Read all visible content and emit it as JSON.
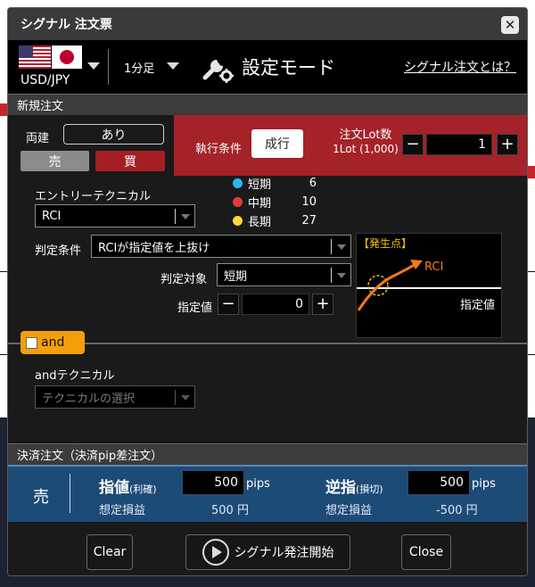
{
  "window": {
    "title": "シグナル 注文票"
  },
  "header": {
    "pair": "USD/JPY",
    "timeframe": "1分足",
    "mode_label": "設定モード",
    "help_link": "シグナル注文とは？"
  },
  "new_order": {
    "section_title": "新規注文",
    "ryodate_label": "両建",
    "ryodate_value": "あり",
    "sell_label": "売",
    "buy_label": "買",
    "exec_label": "執行条件",
    "market_label": "成行",
    "lot_label": "注文Lot数",
    "lot_sub": "1Lot (1,000)",
    "lot_minus": "−",
    "lot_value": "1",
    "lot_plus": "+"
  },
  "entry": {
    "label": "エントリーテクニカル",
    "technical": "RCI",
    "periods": [
      {
        "name": "短期",
        "value": "6",
        "color": "#29b6f6"
      },
      {
        "name": "中期",
        "value": "10",
        "color": "#e53935"
      },
      {
        "name": "長期",
        "value": "27",
        "color": "#fdd835"
      }
    ],
    "judge_label": "判定条件",
    "judge_value": "RCIが指定値を上抜け",
    "target_label": "判定対象",
    "target_value": "短期",
    "value_label": "指定値",
    "value_minus": "−",
    "value_value": "0",
    "value_plus": "+"
  },
  "diagram": {
    "title": "【発生点】",
    "series_label": "RCI",
    "line_label": "指定値"
  },
  "and_block": {
    "tab_label": "and",
    "label": "andテクニカル",
    "select_placeholder": "テクニカルの選択"
  },
  "settlement": {
    "section_title": "決済注文（決済pip差注文）",
    "side": "売",
    "limit_title": "指値",
    "limit_sub": "(利確)",
    "limit_value": "500",
    "limit_unit": "pips",
    "limit_pl_label": "想定損益",
    "limit_pl_value": "500 円",
    "stop_title": "逆指",
    "stop_sub": "(損切)",
    "stop_value": "500",
    "stop_unit": "pips",
    "stop_pl_label": "想定損益",
    "stop_pl_value": "-500 円"
  },
  "footer": {
    "clear_label": "Clear",
    "start_label": "シグナル発注開始",
    "close_label": "Close"
  },
  "colors": {
    "accent_red": "#a52229",
    "and_orange": "#f59e0b",
    "settle_blue": "#1d4b78"
  }
}
